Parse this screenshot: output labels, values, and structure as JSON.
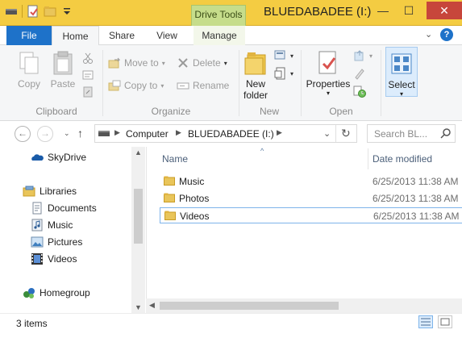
{
  "window": {
    "context_tab": "Drive Tools",
    "title": "BLUEDABADEE (I:)",
    "minimize": "—",
    "maximize": "☐",
    "close": "✕"
  },
  "tabs": {
    "file": "File",
    "home": "Home",
    "share": "Share",
    "view": "View",
    "manage": "Manage",
    "help": "?"
  },
  "ribbon": {
    "clipboard": {
      "label": "Clipboard",
      "copy": "Copy",
      "paste": "Paste"
    },
    "organize": {
      "label": "Organize",
      "move_to": "Move to",
      "copy_to": "Copy to",
      "delete": "Delete",
      "rename": "Rename"
    },
    "new": {
      "label": "New",
      "new_folder_line1": "New",
      "new_folder_line2": "folder"
    },
    "open": {
      "label": "Open",
      "properties": "Properties"
    },
    "select": {
      "select": "Select"
    }
  },
  "address": {
    "back": "←",
    "forward": "→",
    "up": "↑",
    "crumbs": [
      "Computer",
      "BLUEDABADEE (I:)"
    ],
    "refresh": "↻",
    "search_placeholder": "Search BL..."
  },
  "nav": {
    "skydrive": "SkyDrive",
    "libraries": "Libraries",
    "documents": "Documents",
    "music": "Music",
    "pictures": "Pictures",
    "videos": "Videos",
    "homegroup": "Homegroup"
  },
  "columns": {
    "name": "Name",
    "date": "Date modified"
  },
  "files": [
    {
      "name": "Music",
      "date": "6/25/2013 11:38 AM"
    },
    {
      "name": "Photos",
      "date": "6/25/2013 11:38 AM"
    },
    {
      "name": "Videos",
      "date": "6/25/2013 11:38 AM"
    }
  ],
  "status": {
    "count": "3 items"
  },
  "colors": {
    "titlebar": "#f4cc42",
    "file_tab": "#1e72c9",
    "drive_tools": "#c6dd8b",
    "close": "#c7463b"
  }
}
